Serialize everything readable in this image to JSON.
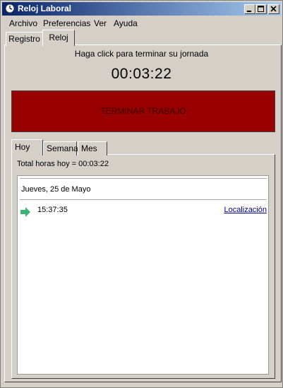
{
  "window": {
    "title": "Reloj Laboral"
  },
  "menu": [
    "Archivo",
    "Preferencias",
    "Ver",
    "Ayuda"
  ],
  "outer_tabs": [
    {
      "label": "Registro",
      "active": false
    },
    {
      "label": "Reloj",
      "active": true
    }
  ],
  "clock": {
    "instruction": "Haga click para terminar su jornada",
    "elapsed": "00:03:22",
    "stop_label": "TERMINAR TRABAJO",
    "stop_color": "#990000"
  },
  "inner_tabs": [
    {
      "label": "Hoy",
      "active": true
    },
    {
      "label": "Semana",
      "active": false
    },
    {
      "label": "Mes",
      "active": false
    }
  ],
  "today": {
    "total": "Total horas hoy = 00:03:22",
    "day_title": "Jueves, 25 de Mayo",
    "entries": [
      {
        "time": "15:37:35",
        "icon": "arrow-right-icon",
        "link": "Localización",
        "arrow_color": "#3cb371"
      }
    ]
  }
}
